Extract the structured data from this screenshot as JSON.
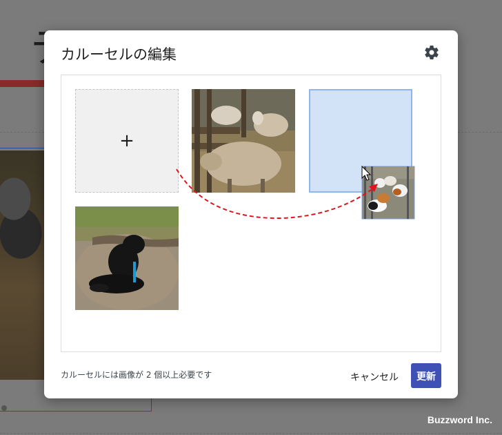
{
  "background": {
    "title_glyph": "テ"
  },
  "modal": {
    "title": "カルーセルの編集",
    "gallery": {
      "add_tile_symbol": "+",
      "images": [
        {
          "name": "sheep-at-fence",
          "alt": "Sheep at fence"
        },
        {
          "name": "black-lamb-lying",
          "alt": "Black lamb lying"
        },
        {
          "name": "guinea-pigs-dragged",
          "alt": "Guinea pigs"
        }
      ]
    },
    "footer": {
      "note": "カルーセルには画像が 2 個以上必要です",
      "cancel_label": "キャンセル",
      "update_label": "更新"
    }
  },
  "watermark": "Buzzword Inc.",
  "colors": {
    "primary_button": "#3f51b5",
    "drop_target": "#d2e3f8",
    "drop_target_border": "#8fb4ee",
    "annotation_arrow": "#e0141e"
  }
}
